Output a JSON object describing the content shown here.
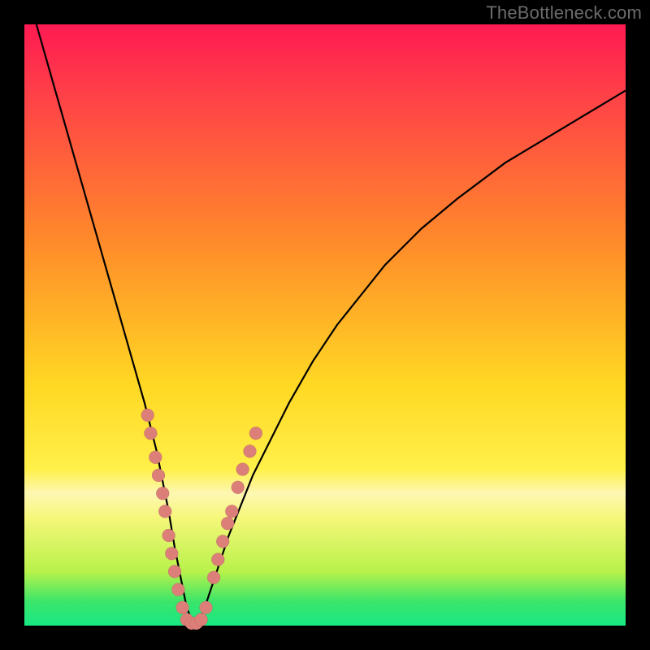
{
  "watermark": "TheBottleneck.com",
  "colors": {
    "top": "#ff1a52",
    "red": "#ff3b4a",
    "orange": "#ff8a2a",
    "yellow": "#ffd823",
    "lightyellow": "#fff04a",
    "paleband": "#fdf7b3",
    "paleyellow": "#f6f77a",
    "yellowgreen": "#b8f24a",
    "green": "#3be56a",
    "brightgreen": "#17e884"
  },
  "chart_data": {
    "type": "line",
    "title": "",
    "xlabel": "",
    "ylabel": "",
    "xlim": [
      0,
      100
    ],
    "ylim": [
      0,
      100
    ],
    "grid": false,
    "legend": false,
    "series": [
      {
        "name": "bottleneck-curve",
        "x": [
          2,
          4,
          6,
          8,
          10,
          12,
          14,
          16,
          18,
          20,
          22,
          24,
          25,
          26,
          27,
          28,
          29,
          30,
          32,
          34,
          36,
          38,
          40,
          44,
          48,
          52,
          56,
          60,
          66,
          72,
          80,
          90,
          100
        ],
        "y": [
          100,
          93,
          86,
          79,
          72,
          65,
          58,
          51,
          44,
          37,
          29,
          19,
          13,
          8,
          3,
          0.5,
          0.5,
          3,
          9,
          15,
          20,
          25,
          29,
          37,
          44,
          50,
          55,
          60,
          66,
          71,
          77,
          83,
          89
        ]
      }
    ],
    "scatter_points": {
      "name": "highlighted-samples",
      "points": [
        {
          "x": 20.5,
          "y": 35
        },
        {
          "x": 21.0,
          "y": 32
        },
        {
          "x": 21.8,
          "y": 28
        },
        {
          "x": 22.3,
          "y": 25
        },
        {
          "x": 23.0,
          "y": 22
        },
        {
          "x": 23.4,
          "y": 19
        },
        {
          "x": 24.0,
          "y": 15
        },
        {
          "x": 24.5,
          "y": 12
        },
        {
          "x": 25.0,
          "y": 9
        },
        {
          "x": 25.6,
          "y": 6
        },
        {
          "x": 26.3,
          "y": 3
        },
        {
          "x": 27.0,
          "y": 1
        },
        {
          "x": 27.8,
          "y": 0.4
        },
        {
          "x": 28.6,
          "y": 0.4
        },
        {
          "x": 29.4,
          "y": 1
        },
        {
          "x": 30.2,
          "y": 3
        },
        {
          "x": 31.5,
          "y": 8
        },
        {
          "x": 32.2,
          "y": 11
        },
        {
          "x": 33.0,
          "y": 14
        },
        {
          "x": 33.8,
          "y": 17
        },
        {
          "x": 34.5,
          "y": 19
        },
        {
          "x": 35.5,
          "y": 23
        },
        {
          "x": 36.3,
          "y": 26
        },
        {
          "x": 37.5,
          "y": 29
        },
        {
          "x": 38.5,
          "y": 32
        }
      ]
    },
    "annotations": []
  }
}
